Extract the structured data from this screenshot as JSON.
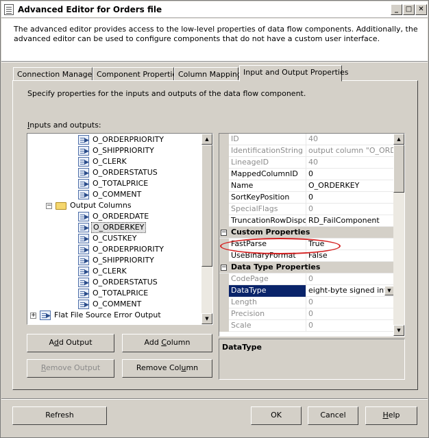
{
  "window": {
    "title": "Advanced Editor for Orders file"
  },
  "header": {
    "text": "The advanced editor provides access to the low-level properties of data flow components. Additionally, the advanced editor can be used to configure components that do not have a custom user interface."
  },
  "tabs": [
    {
      "label": "Connection Managers"
    },
    {
      "label": "Component Properties"
    },
    {
      "label": "Column Mappings"
    },
    {
      "label": "Input and Output Properties",
      "active": true
    }
  ],
  "panel": {
    "description": "Specify properties for the inputs and outputs of the data flow component.",
    "io_label_prefix": "I",
    "io_label_rest": "nputs and outputs:"
  },
  "tree": {
    "items": [
      {
        "label": "O_ORDERPRIORITY",
        "level": 2,
        "icon": "column-icon"
      },
      {
        "label": "O_SHIPPRIORITY",
        "level": 2,
        "icon": "column-icon"
      },
      {
        "label": "O_CLERK",
        "level": 2,
        "icon": "column-icon"
      },
      {
        "label": "O_ORDERSTATUS",
        "level": 2,
        "icon": "column-icon"
      },
      {
        "label": "O_TOTALPRICE",
        "level": 2,
        "icon": "column-icon"
      },
      {
        "label": "O_COMMENT",
        "level": 2,
        "icon": "column-icon"
      },
      {
        "label": "Output Columns",
        "level": 1,
        "icon": "folder-icon",
        "expander": "−"
      },
      {
        "label": "O_ORDERDATE",
        "level": 2,
        "icon": "output-column-icon"
      },
      {
        "label": "O_ORDERKEY",
        "level": 2,
        "icon": "output-column-icon",
        "selected": true
      },
      {
        "label": "O_CUSTKEY",
        "level": 2,
        "icon": "output-column-icon"
      },
      {
        "label": "O_ORDERPRIORITY",
        "level": 2,
        "icon": "output-column-icon"
      },
      {
        "label": "O_SHIPPRIORITY",
        "level": 2,
        "icon": "output-column-icon"
      },
      {
        "label": "O_CLERK",
        "level": 2,
        "icon": "output-column-icon"
      },
      {
        "label": "O_ORDERSTATUS",
        "level": 2,
        "icon": "output-column-icon"
      },
      {
        "label": "O_TOTALPRICE",
        "level": 2,
        "icon": "output-column-icon"
      },
      {
        "label": "O_COMMENT",
        "level": 2,
        "icon": "output-column-icon"
      },
      {
        "label": "Flat File Source Error Output",
        "level": 0,
        "icon": "output-icon",
        "expander": "+"
      }
    ]
  },
  "buttons": {
    "add_output_pre": "A",
    "add_output_ul": "d",
    "add_output_post": "d Output",
    "add_column_pre": "Add ",
    "add_column_ul": "C",
    "add_column_post": "olumn",
    "remove_output_pre": "",
    "remove_output_ul": "R",
    "remove_output_post": "emove Output",
    "remove_column_pre": "Remove Col",
    "remove_column_ul": "u",
    "remove_column_post": "mn",
    "refresh": "Refresh",
    "ok": "OK",
    "cancel": "Cancel",
    "help_ul": "H",
    "help_post": "elp"
  },
  "properties": {
    "rows": [
      {
        "name": "ID",
        "value": "40",
        "gray": true
      },
      {
        "name": "IdentificationString",
        "value": "output column \"O_ORDER",
        "gray": true
      },
      {
        "name": "LineageID",
        "value": "40",
        "gray": true
      },
      {
        "name": "MappedColumnID",
        "value": "0"
      },
      {
        "name": "Name",
        "value": "O_ORDERKEY"
      },
      {
        "name": "SortKeyPosition",
        "value": "0"
      },
      {
        "name": "SpecialFlags",
        "value": "0",
        "gray": true
      },
      {
        "name": "TruncationRowDisposit",
        "value": "RD_FailComponent"
      },
      {
        "name": "Custom Properties",
        "category": true
      },
      {
        "name": "FastParse",
        "value": "True"
      },
      {
        "name": "UseBinaryFormat",
        "value": "False"
      },
      {
        "name": "Data Type Properties",
        "category": true
      },
      {
        "name": "CodePage",
        "value": "0",
        "gray": true
      },
      {
        "name": "DataType",
        "value": "eight-byte signed integ",
        "selected": true,
        "dropdown": true
      },
      {
        "name": "Length",
        "value": "0",
        "gray": true
      },
      {
        "name": "Precision",
        "value": "0",
        "gray": true
      },
      {
        "name": "Scale",
        "value": "0",
        "gray": true
      }
    ],
    "description_title": "DataType"
  }
}
